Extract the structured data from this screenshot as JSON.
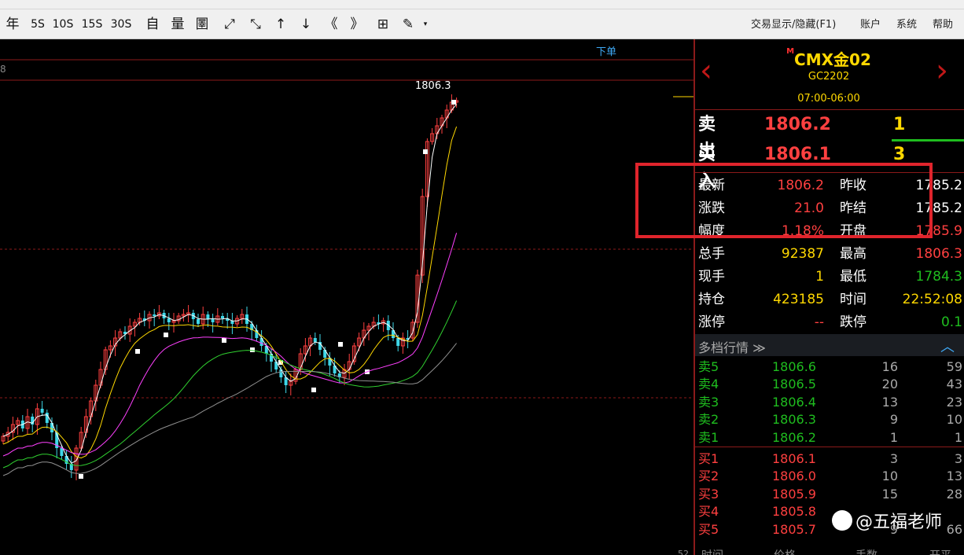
{
  "toolbar": {
    "buttons": [
      "年",
      "5S",
      "10S",
      "15S",
      "30S",
      "自",
      "量",
      "圛",
      "⤢",
      "⤡",
      "↑",
      "↓",
      "《",
      "》",
      "⊞",
      "✎"
    ],
    "menus": [
      "交易显示/隐藏(F1)",
      "账户",
      "系统",
      "帮助"
    ]
  },
  "chart": {
    "order_link": "下单",
    "peak_label": "1806.3",
    "axis_number": "8",
    "corner_number": "52"
  },
  "symbol": {
    "title": "CMX金02",
    "title_mark": "M",
    "code": "GC2202",
    "session": "07:00-06:00",
    "prev_arrow": "‹",
    "next_arrow": "›"
  },
  "book": {
    "sell_label": "卖出",
    "sell_price": "1806.2",
    "sell_vol": "1",
    "buy_label": "买入",
    "buy_price": "1806.1",
    "buy_vol": "3"
  },
  "quote_rows": [
    {
      "l1": "最新",
      "v1": "1806.2",
      "c1": "#ff4040",
      "l2": "昨收",
      "v2": "1785.2",
      "c2": "#ffffff"
    },
    {
      "l1": "涨跌",
      "v1": "21.0",
      "c1": "#ff4040",
      "l2": "昨结",
      "v2": "1785.2",
      "c2": "#ffffff"
    },
    {
      "l1": "幅度",
      "v1": "1.18%",
      "c1": "#ff4040",
      "l2": "开盘",
      "v2": "1785.9",
      "c2": "#ff4040"
    },
    {
      "l1": "总手",
      "v1": "92387",
      "c1": "#ffd800",
      "l2": "最高",
      "v2": "1806.3",
      "c2": "#ff4040"
    },
    {
      "l1": "现手",
      "v1": "1",
      "c1": "#ffd800",
      "l2": "最低",
      "v2": "1784.3",
      "c2": "#1fbd1f"
    },
    {
      "l1": "持仓",
      "v1": "423185",
      "c1": "#ffd800",
      "l2": "时间",
      "v2": "22:52:08",
      "c2": "#ffd800"
    },
    {
      "l1": "涨停",
      "v1": "--",
      "c1": "#ff4040",
      "l2": "跌停",
      "v2": "0.1",
      "c2": "#1fbd1f"
    }
  ],
  "depth": {
    "title": "多档行情 ≫",
    "caret": "︿",
    "asks": [
      {
        "label": "卖5",
        "price": "1806.6",
        "vol": "16",
        "cum": "59"
      },
      {
        "label": "卖4",
        "price": "1806.5",
        "vol": "20",
        "cum": "43"
      },
      {
        "label": "卖3",
        "price": "1806.4",
        "vol": "13",
        "cum": "23"
      },
      {
        "label": "卖2",
        "price": "1806.3",
        "vol": "9",
        "cum": "10"
      },
      {
        "label": "卖1",
        "price": "1806.2",
        "vol": "1",
        "cum": "1"
      }
    ],
    "bids": [
      {
        "label": "买1",
        "price": "1806.1",
        "vol": "3",
        "cum": "3"
      },
      {
        "label": "买2",
        "price": "1806.0",
        "vol": "10",
        "cum": "13"
      },
      {
        "label": "买3",
        "price": "1805.9",
        "vol": "15",
        "cum": "28"
      },
      {
        "label": "买4",
        "price": "1805.8",
        "vol": "",
        "cum": ""
      },
      {
        "label": "买5",
        "price": "1805.7",
        "vol": "9",
        "cum": "66"
      }
    ],
    "footer": [
      "时间",
      "价格",
      "手数",
      "开平"
    ]
  },
  "watermark": "@五福老师",
  "colors": {
    "up": "#ff4040",
    "down": "#1fbd1f",
    "accent": "#ffd800",
    "candle_down": "#3fd7e8"
  }
}
